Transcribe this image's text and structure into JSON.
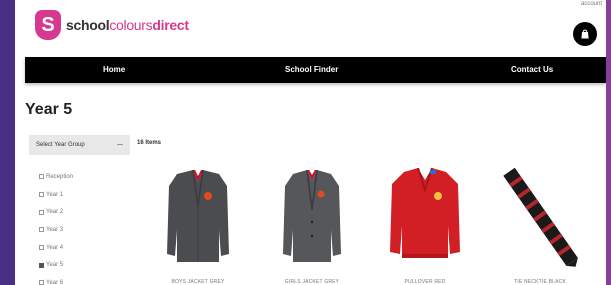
{
  "header": {
    "account_link": "account",
    "logo": {
      "badge_letter": "S",
      "word1": "school",
      "word2": "colours",
      "word3": "direct"
    }
  },
  "nav": [
    "Home",
    "School Finder",
    "Contact Us"
  ],
  "page": {
    "title": "Year 5"
  },
  "filters": {
    "select_label": "Select Year Group",
    "item_count": "16 Items",
    "options": [
      {
        "label": "Reception",
        "checked": false
      },
      {
        "label": "Year 1",
        "checked": false
      },
      {
        "label": "Year 2",
        "checked": false
      },
      {
        "label": "Year 3",
        "checked": false
      },
      {
        "label": "Year 4",
        "checked": false
      },
      {
        "label": "Year 5",
        "checked": true
      },
      {
        "label": "Year 6",
        "checked": false
      }
    ]
  },
  "products": [
    {
      "name": "BOYS JACKET GREY"
    },
    {
      "name": "GIRLS JACKET GREY"
    },
    {
      "name": "PULLOVER RED"
    },
    {
      "name": "TIE NECKTIE BLACK"
    }
  ],
  "colors": {
    "brand_pink": "#d6398f",
    "nav_bg": "#000000",
    "blazer_grey": "#4a4c50",
    "jumper_red": "#d21f25",
    "tie_red": "#b3262c",
    "tie_black": "#1a1a1a"
  }
}
